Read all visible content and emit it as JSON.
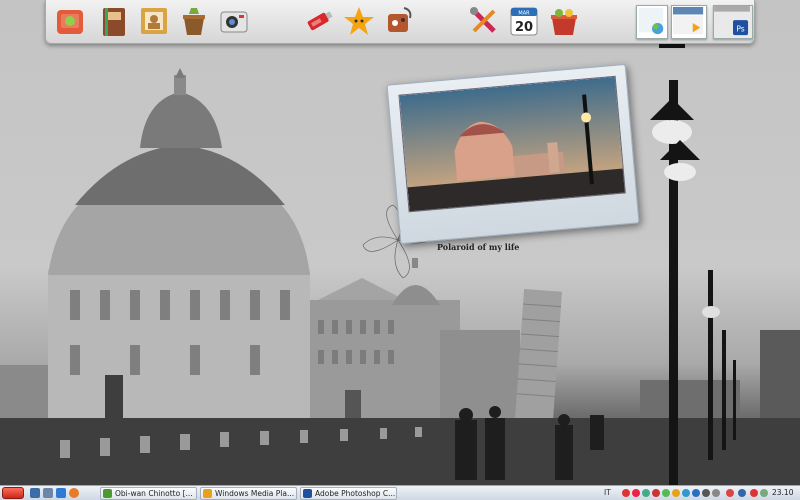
{
  "dock": {
    "apps": [
      {
        "name": "photo-album-icon",
        "color": "#e45b3a"
      },
      {
        "name": "address-book-icon",
        "color": "#8b4b2b"
      },
      {
        "name": "picture-frame-icon",
        "color": "#d9a441"
      },
      {
        "name": "recycle-basket-icon",
        "color": "#7aa93a"
      },
      {
        "name": "polaroid-camera-icon",
        "color": "#e4e4e4"
      },
      {
        "name": "usb-drive-icon",
        "color": "#d8282a"
      },
      {
        "name": "star-icon",
        "color": "#f6a411"
      },
      {
        "name": "gamepad-icon",
        "color": "#b4572e"
      },
      {
        "name": "tools-icon",
        "color": "#c72a55"
      },
      {
        "name": "calendar-icon",
        "color": "#2d6fb5"
      },
      {
        "name": "gift-basket-icon",
        "color": "#c33a2c"
      }
    ],
    "calendar": {
      "month": "MAR",
      "day": "20"
    },
    "photoshop_badge": "Ps"
  },
  "widget": {
    "caption": "Polaroid of my life"
  },
  "taskbar": {
    "tasks": [
      {
        "label": "Obi-wan Chinotto [...",
        "color": "#4c9b2f"
      },
      {
        "label": "Windows Media Pla...",
        "color": "#e8a21a"
      },
      {
        "label": "Adobe Photoshop C...",
        "color": "#1f4f9e"
      }
    ],
    "language": "IT",
    "clock": "23.10",
    "accent": "#c8281a"
  }
}
